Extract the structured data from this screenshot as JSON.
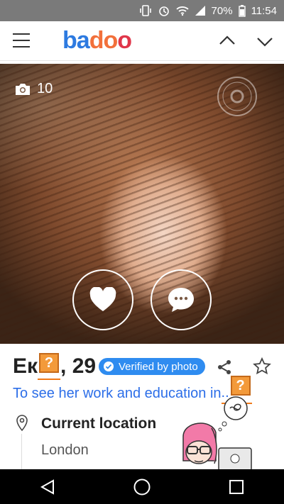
{
  "status_bar": {
    "battery": "70%",
    "time": "11:54"
  },
  "app": {
    "logo": "badoo"
  },
  "photo": {
    "count": "10"
  },
  "profile": {
    "name_start": "Ек",
    "name_mid": "...",
    "age_text": ", 29",
    "verified_label": "Verified by photo",
    "work_text": "To see her work and education in",
    "work_ellipsis": "..",
    "location_title": "Current location",
    "location_value": "London"
  },
  "colors": {
    "link": "#2c6ee8",
    "verified": "#2f8cf0",
    "logo_blue": "#2d7ae0",
    "logo_orange": "#f2703b",
    "logo_red": "#e0364a"
  }
}
